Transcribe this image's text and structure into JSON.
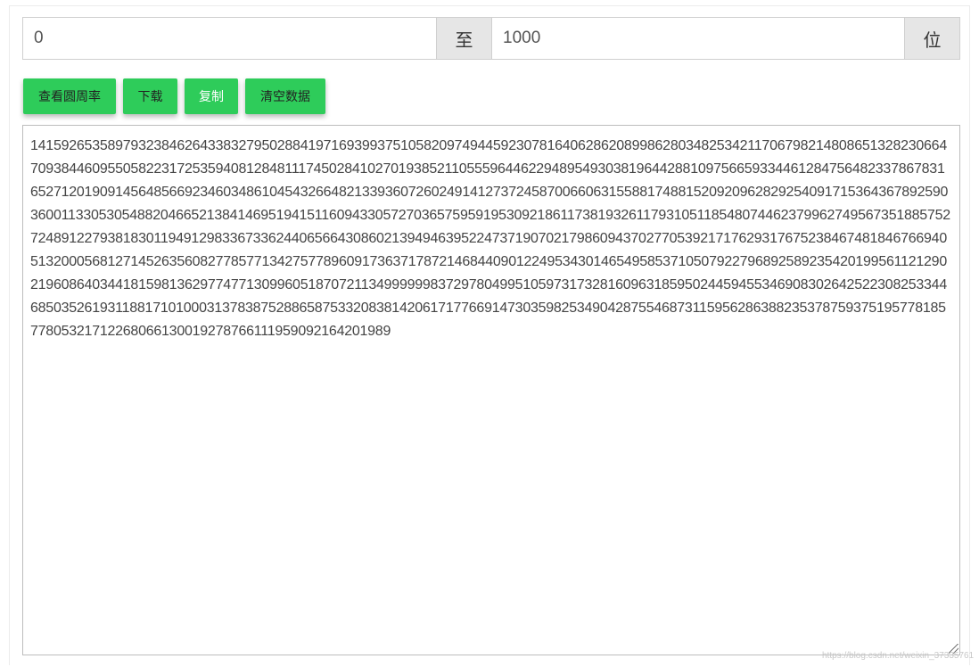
{
  "range": {
    "from_value": "0",
    "separator_label": "至",
    "to_value": "1000",
    "unit_label": "位"
  },
  "toolbar": {
    "view_label": "查看圆周率",
    "download_label": "下载",
    "copy_label": "复制",
    "clear_label": "清空数据"
  },
  "output": {
    "digits": "1415926535897932384626433832795028841971693993751058209749445923078164062862089986280348253421170679821480865132823066470938446095505822317253594081284811174502841027019385211055596446229489549303819644288109756659334461284756482337867831652712019091456485669234603486104543266482133936072602491412737245870066063155881748815209209628292540917153643678925903600113305305488204665213841469519415116094330572703657595919530921861173819326117931051185480744623799627495673518857527248912279381830119491298336733624406566430860213949463952247371907021798609437027705392171762931767523846748184676694051320005681271452635608277857713427577896091736371787214684409012249534301465495853710507922796892589235420199561121290219608640344181598136297747713099605187072113499999983729780499510597317328160963185950244594553469083026425223082533446850352619311881710100031378387528865875332083814206171776691473035982534904287554687311595628638823537875937519577818577805321712268066130019278766111959092164201989",
    "watermark": "https://blog.csdn.net/weixin_37335761"
  },
  "colors": {
    "button_green": "#2ecc5a",
    "addon_gray": "#e6e6e6",
    "border_gray": "#cfcfcf"
  }
}
